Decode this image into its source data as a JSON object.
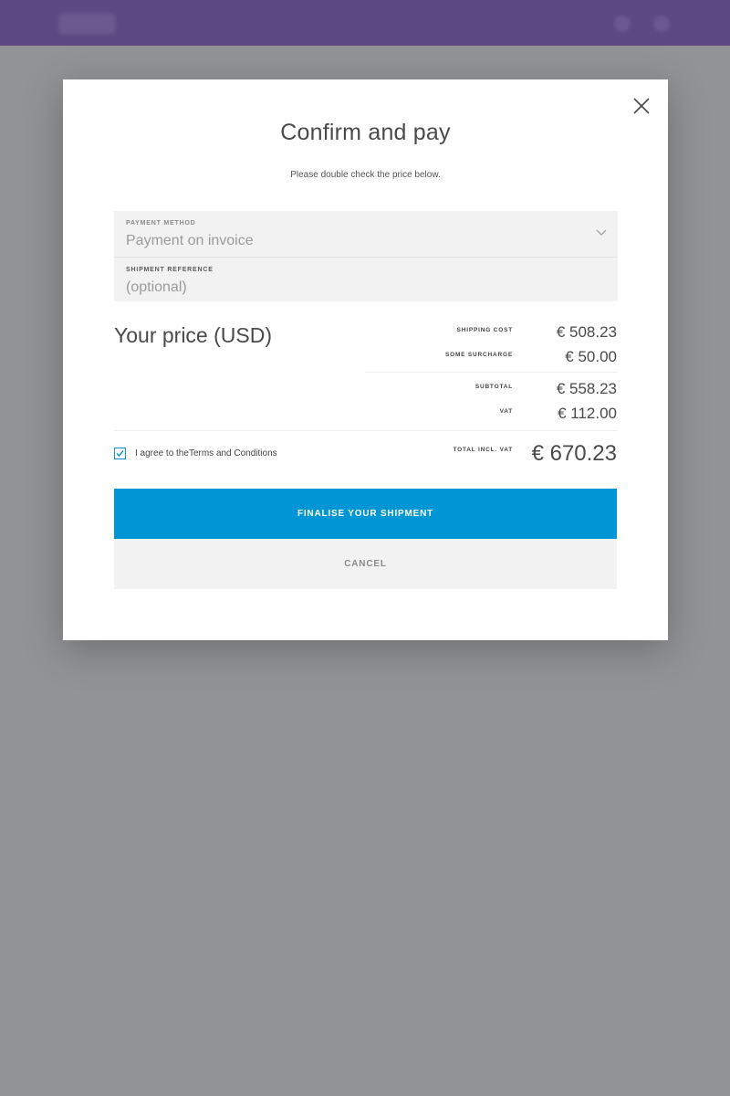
{
  "modal": {
    "title": "Confirm and pay",
    "subtitle": "Please double check the price below.",
    "payment_method": {
      "label": "PAYMENT METHOD",
      "value": "Payment on invoice"
    },
    "shipment_reference": {
      "label": "SHIPMENT REFERENCE",
      "placeholder": "(optional)"
    },
    "price_title": "Your price (USD)",
    "price_rows": {
      "shipping_cost": {
        "label": "SHIPPING COST",
        "value": "€ 508.23"
      },
      "surcharge": {
        "label": "SOME SURCHARGE",
        "value": "€ 50.00"
      },
      "subtotal": {
        "label": "SUBTOTAL",
        "value": "€ 558.23"
      },
      "vat": {
        "label": "VAT",
        "value": "€ 112.00"
      },
      "total": {
        "label": "TOTAL INCL. VAT",
        "value": "€ 670.23"
      }
    },
    "terms": {
      "prefix": "I agree to the",
      "link": "Terms and Conditions",
      "checked": true
    },
    "finalise_button": "FINALISE YOUR SHIPMENT",
    "cancel_button": "CANCEL"
  },
  "icons": {
    "close": "close-icon",
    "dropdown": "chevron-down-icon",
    "checkbox": "checkmark-icon"
  },
  "colors": {
    "accent": "#0096d6",
    "header": "#5d4a82",
    "overlay": "#929395"
  }
}
